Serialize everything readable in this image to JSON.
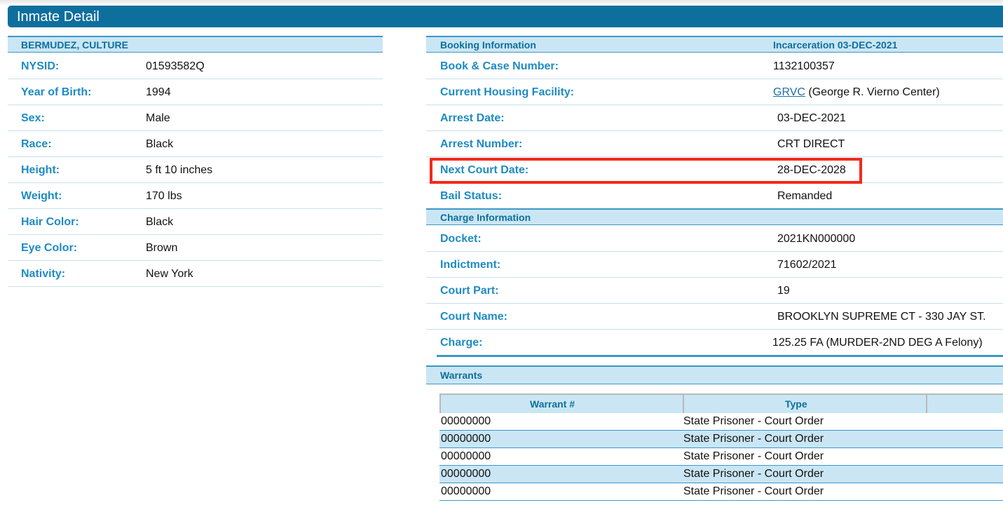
{
  "page": {
    "title": "Inmate Detail"
  },
  "personal": {
    "name": "BERMUDEZ, CULTURE",
    "rows": [
      {
        "label": "NYSID:",
        "value": "01593582Q"
      },
      {
        "label": "Year of Birth:",
        "value": "1994"
      },
      {
        "label": "Sex:",
        "value": "Male"
      },
      {
        "label": "Race:",
        "value": "Black"
      },
      {
        "label": "Height:",
        "value": "5 ft 10 inches"
      },
      {
        "label": "Weight:",
        "value": "170 lbs"
      },
      {
        "label": "Hair Color:",
        "value": "Black"
      },
      {
        "label": "Eye Color:",
        "value": "Brown"
      },
      {
        "label": "Nativity:",
        "value": "New York"
      }
    ]
  },
  "booking": {
    "header_left": "Booking Information",
    "header_right": "Incarceration 03-DEC-2021",
    "book_case_label": "Book & Case Number:",
    "book_case_value": "1132100357",
    "housing_label": "Current Housing Facility:",
    "housing_link": "GRVC",
    "housing_name": "(George R. Vierno Center)",
    "arrest_date_label": "Arrest Date:",
    "arrest_date_value": "03-DEC-2021",
    "arrest_number_label": "Arrest Number:",
    "arrest_number_value": "CRT DIRECT",
    "next_court_label": "Next Court Date:",
    "next_court_value": "28-DEC-2028",
    "bail_label": "Bail Status:",
    "bail_value": "Remanded"
  },
  "charge": {
    "header": "Charge Information",
    "docket_label": "Docket:",
    "docket_value": "2021KN000000",
    "indictment_label": "Indictment:",
    "indictment_value": "71602/2021",
    "court_part_label": "Court Part:",
    "court_part_value": "19",
    "court_name_label": "Court Name:",
    "court_name_value": "BROOKLYN SUPREME CT - 330 JAY ST.",
    "charge_label": "Charge:",
    "charge_value": "125.25 FA (MURDER-2ND DEG A Felony)"
  },
  "warrants": {
    "header": "Warrants",
    "col_number": "Warrant #",
    "col_type": "Type",
    "rows": [
      {
        "number": "00000000",
        "type": "State Prisoner - Court Order"
      },
      {
        "number": "00000000",
        "type": "State Prisoner - Court Order"
      },
      {
        "number": "00000000",
        "type": "State Prisoner - Court Order"
      },
      {
        "number": "00000000",
        "type": "State Prisoner - Court Order"
      },
      {
        "number": "00000000",
        "type": "State Prisoner - Court Order"
      }
    ]
  },
  "colors": {
    "title_bar": "#0e6f9d",
    "header_fill": "#cae6f4",
    "label_text": "#1e8bc3",
    "highlight": "#f22a1a"
  }
}
